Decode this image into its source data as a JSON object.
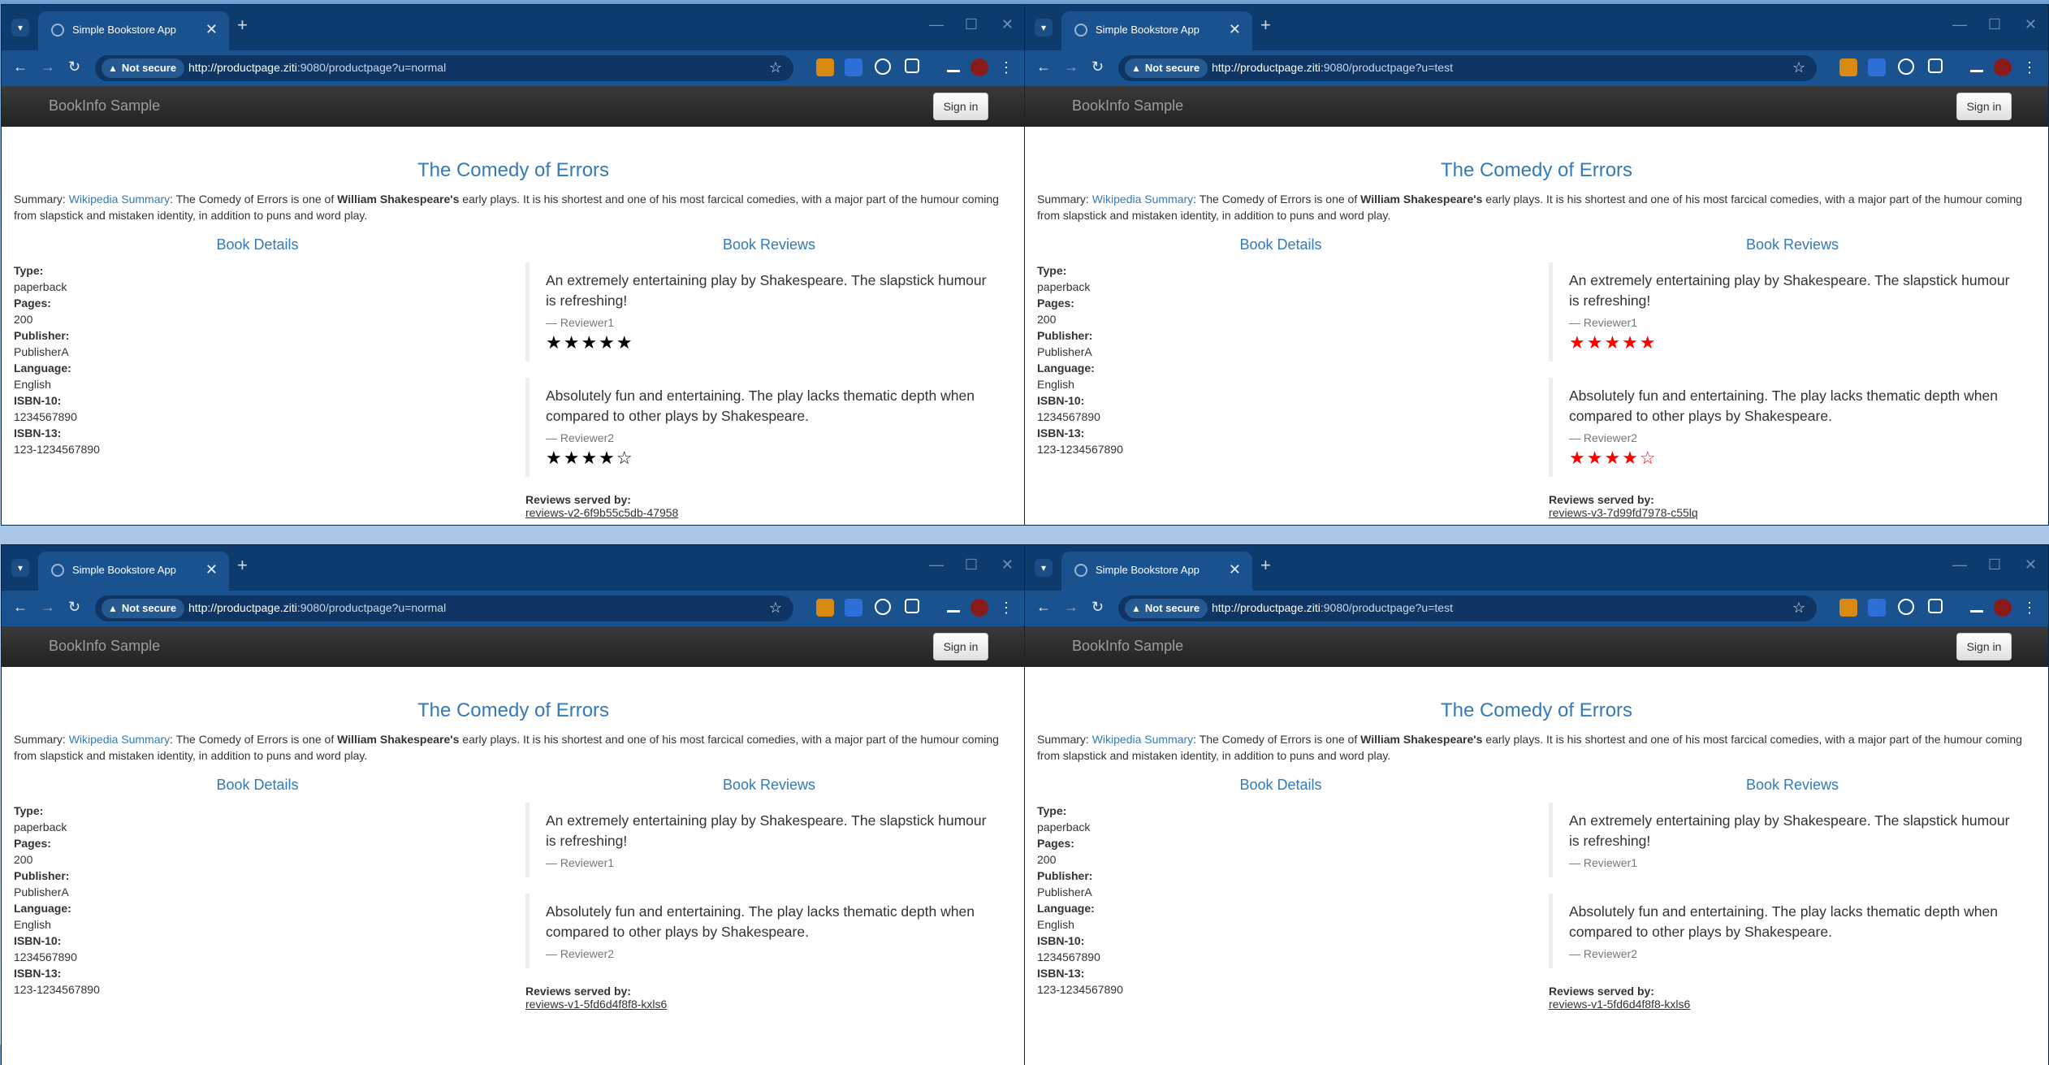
{
  "windows": [
    {
      "tab_title": "Simple Bookstore App",
      "secure_label": "Not secure",
      "url_host": "http://productpage.ziti",
      "url_rest": ":9080/productpage?u=normal",
      "star_color": "#000000",
      "reviews": [
        {
          "text": "An extremely entertaining play by Shakespeare. The slapstick humour is refreshing!",
          "reviewer": "— Reviewer1",
          "stars": "★★★★★"
        },
        {
          "text": "Absolutely fun and entertaining. The play lacks thematic depth when compared to other plays by Shakespeare.",
          "reviewer": "— Reviewer2",
          "stars": "★★★★☆"
        }
      ],
      "served_label": "Reviews served by:",
      "served_pod": "reviews-v2-6f9b55c5db-47958"
    },
    {
      "tab_title": "Simple Bookstore App",
      "secure_label": "Not secure",
      "url_host": "http://productpage.ziti",
      "url_rest": ":9080/productpage?u=test",
      "star_color": "#ff0000",
      "reviews": [
        {
          "text": "An extremely entertaining play by Shakespeare. The slapstick humour is refreshing!",
          "reviewer": "— Reviewer1",
          "stars": "★★★★★"
        },
        {
          "text": "Absolutely fun and entertaining. The play lacks thematic depth when compared to other plays by Shakespeare.",
          "reviewer": "— Reviewer2",
          "stars": "★★★★☆"
        }
      ],
      "served_label": "Reviews served by:",
      "served_pod": "reviews-v3-7d99fd7978-c55lq"
    },
    {
      "tab_title": "Simple Bookstore App",
      "secure_label": "Not secure",
      "url_host": "http://productpage.ziti",
      "url_rest": ":9080/productpage?u=normal",
      "star_color": "#000000",
      "reviews": [
        {
          "text": "An extremely entertaining play by Shakespeare. The slapstick humour is refreshing!",
          "reviewer": "— Reviewer1",
          "stars": ""
        },
        {
          "text": "Absolutely fun and entertaining. The play lacks thematic depth when compared to other plays by Shakespeare.",
          "reviewer": "— Reviewer2",
          "stars": ""
        }
      ],
      "served_label": "Reviews served by:",
      "served_pod": "reviews-v1-5fd6d4f8f8-kxls6"
    },
    {
      "tab_title": "Simple Bookstore App",
      "secure_label": "Not secure",
      "url_host": "http://productpage.ziti",
      "url_rest": ":9080/productpage?u=test",
      "star_color": "#000000",
      "reviews": [
        {
          "text": "An extremely entertaining play by Shakespeare. The slapstick humour is refreshing!",
          "reviewer": "— Reviewer1",
          "stars": ""
        },
        {
          "text": "Absolutely fun and entertaining. The play lacks thematic depth when compared to other plays by Shakespeare.",
          "reviewer": "— Reviewer2",
          "stars": ""
        }
      ],
      "served_label": "Reviews served by:",
      "served_pod": "reviews-v1-5fd6d4f8f8-kxls6"
    }
  ],
  "page": {
    "brand": "BookInfo Sample",
    "signin": "Sign in",
    "title": "The Comedy of Errors",
    "summary_prefix": "Summary: ",
    "summary_link": "Wikipedia Summary",
    "summary_mid": ": The Comedy of Errors is one of ",
    "summary_bold": "William Shakespeare's",
    "summary_rest": " early plays. It is his shortest and one of his most farcical comedies, with a major part of the humour coming from slapstick and mistaken identity, in addition to puns and word play.",
    "details_heading": "Book Details",
    "reviews_heading": "Book Reviews",
    "details": [
      {
        "label": "Type:",
        "value": "paperback"
      },
      {
        "label": "Pages:",
        "value": "200"
      },
      {
        "label": "Publisher:",
        "value": "PublisherA"
      },
      {
        "label": "Language:",
        "value": "English"
      },
      {
        "label": "ISBN-10:",
        "value": "1234567890"
      },
      {
        "label": "ISBN-13:",
        "value": "123-1234567890"
      }
    ]
  },
  "icons": {
    "tab_menu": "▾",
    "close": "✕",
    "newtab": "+",
    "minimize": "—",
    "maximize": "☐",
    "back": "←",
    "forward": "→",
    "reload": "↻",
    "warning": "▲",
    "star": "☆"
  }
}
